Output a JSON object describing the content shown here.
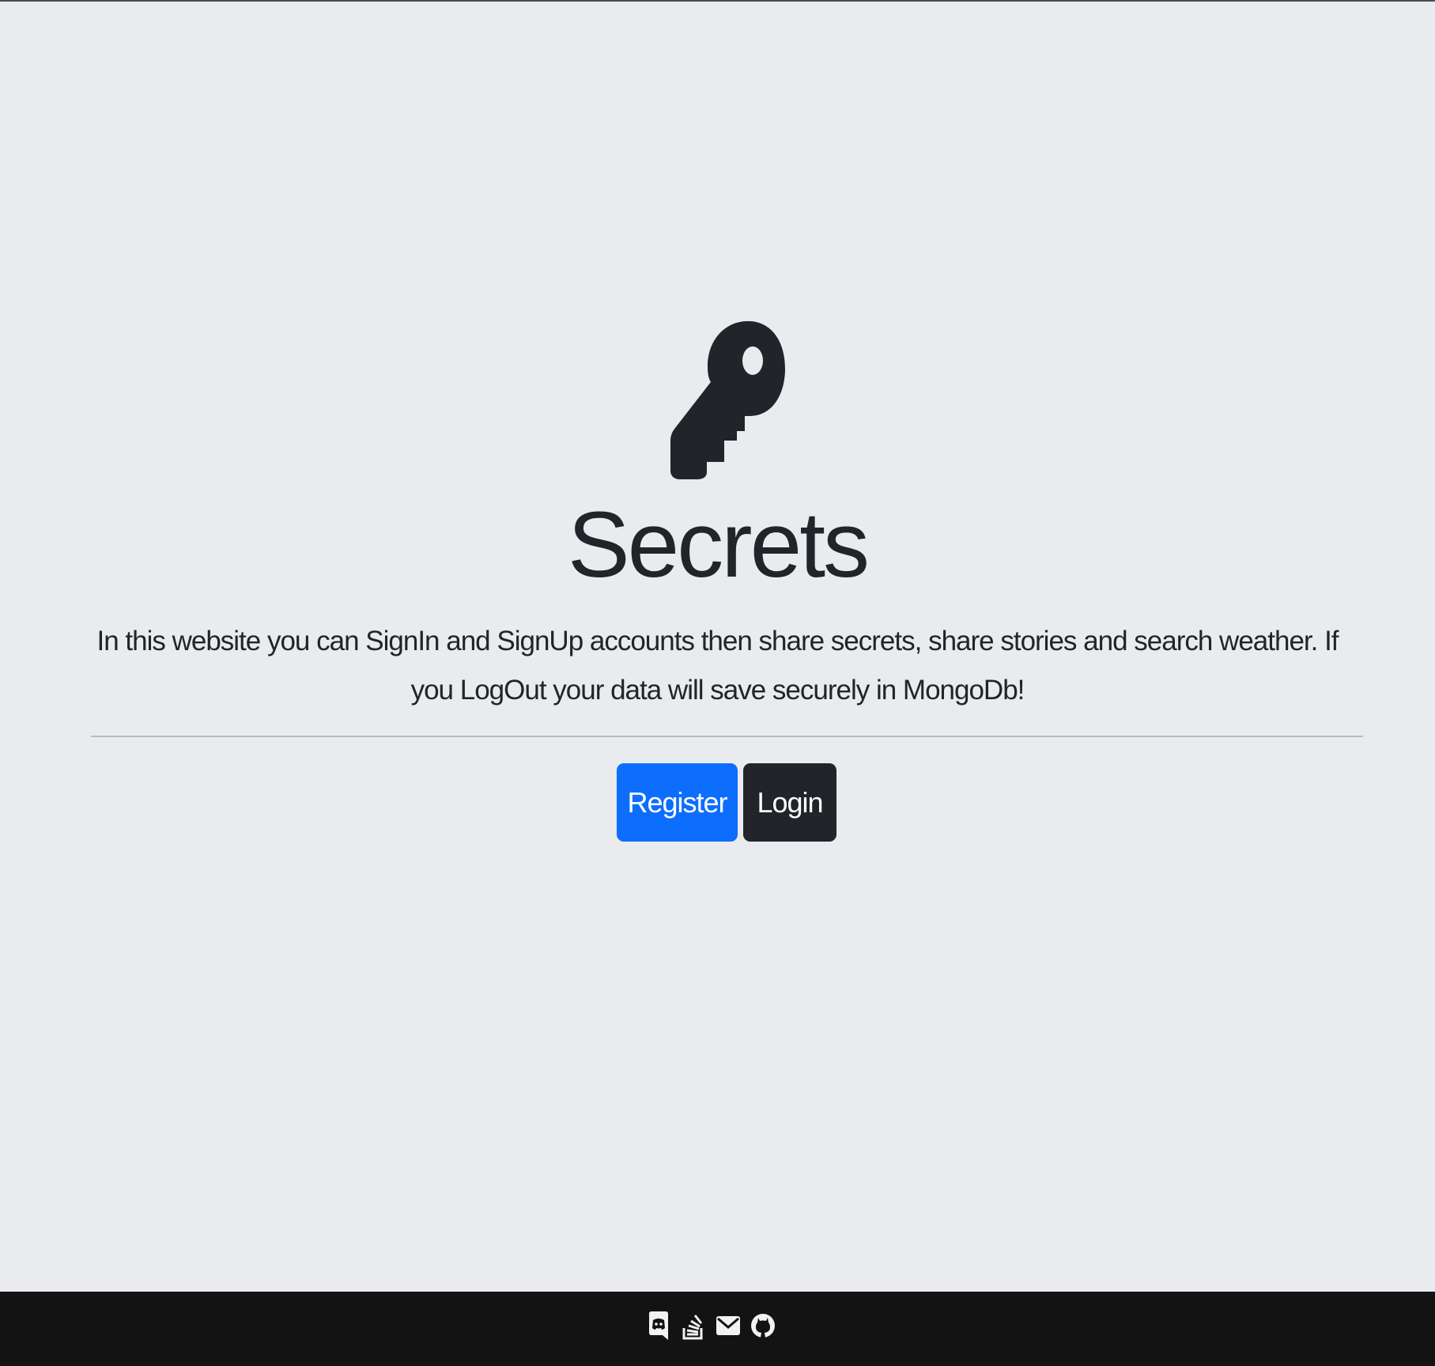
{
  "page": {
    "background": "#e9ebee"
  },
  "hero": {
    "icon": "key-icon",
    "title": "Secrets",
    "lead": "In this website you can SignIn and SignUp accounts then share secrets, share stories and search weather. If you LogOut your data will save securely in MongoDb!"
  },
  "actions": {
    "register_label": "Register",
    "register_color": "#0d6efd",
    "login_label": "Login",
    "login_color": "#212529"
  },
  "footer": {
    "background": "#131313",
    "icons": [
      "discord-icon",
      "stack-overflow-icon",
      "envelope-icon",
      "github-icon"
    ]
  }
}
